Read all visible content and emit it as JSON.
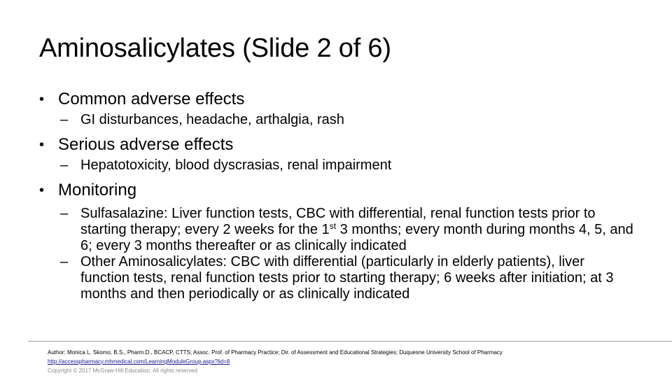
{
  "slide": {
    "title": "Aminosalicylates (Slide 2 of 6)",
    "bullets": [
      {
        "text": "Common adverse effects",
        "subitems": [
          {
            "text": "GI disturbances, headache, arthalgia, rash"
          }
        ]
      },
      {
        "text": "Serious adverse effects",
        "subitems": [
          {
            "text": "Hepatotoxicity, blood dyscrasias, renal impairment"
          }
        ]
      },
      {
        "text": "Monitoring",
        "subitems": [
          {
            "before_sup": "Sulfasalazine:  Liver function tests, CBC with differential, renal function tests prior to starting therapy; every 2 weeks for the 1",
            "sup": "st",
            "after_sup": " 3 months; every month during months 4, 5, and 6; every 3 months thereafter or as clinically indicated"
          },
          {
            "text": "Other Aminosalicylates:  CBC with differential (particularly in elderly patients), liver function tests, renal function tests prior to starting therapy; 6 weeks after initiation; at 3 months and then periodically or as clinically indicated"
          }
        ]
      }
    ],
    "bullet_glyph": "•",
    "dash_glyph": "–"
  },
  "footer": {
    "author": "Author: Monica L. Skomo, B.S., Pharm.D., BCACP, CTTS; Assoc. Prof. of Pharmacy Practice; Dir. of Assessment and Educational Strategies; Duquesne University School of Pharmacy",
    "link": "http://accesspharmacy.mhmedical.com/LearningModuleGroup.aspx?lid=8",
    "copyright": "Copyright © 2017 McGraw-Hill Education. All rights reserved"
  },
  "colors": {
    "text": "#000000",
    "link": "#1a1a8c",
    "copyright": "#8a8a8a",
    "divider": "#a0a0a0"
  }
}
